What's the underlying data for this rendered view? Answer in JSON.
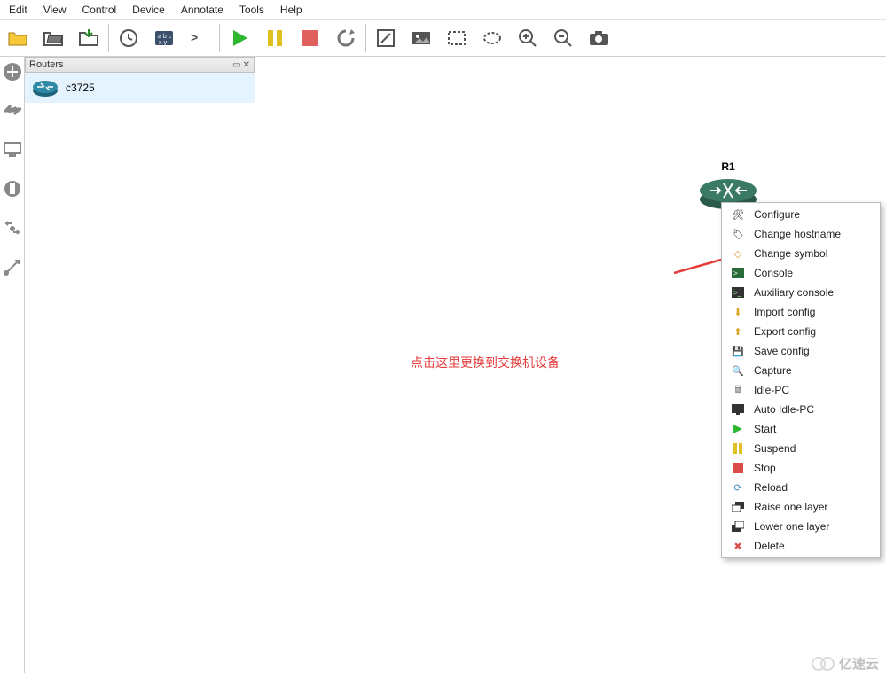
{
  "menu": [
    "Edit",
    "View",
    "Control",
    "Device",
    "Annotate",
    "Tools",
    "Help"
  ],
  "sidebar": {
    "title": "Routers",
    "item": "c3725"
  },
  "canvas": {
    "router_label": "R1",
    "annotation_text": "点击这里更换到交换机设备"
  },
  "context_menu": [
    {
      "label": "Configure"
    },
    {
      "label": "Change hostname"
    },
    {
      "label": "Change symbol"
    },
    {
      "label": "Console"
    },
    {
      "label": "Auxiliary console"
    },
    {
      "label": "Import config"
    },
    {
      "label": "Export config"
    },
    {
      "label": "Save config"
    },
    {
      "label": "Capture"
    },
    {
      "label": "Idle-PC"
    },
    {
      "label": "Auto Idle-PC"
    },
    {
      "label": "Start"
    },
    {
      "label": "Suspend"
    },
    {
      "label": "Stop"
    },
    {
      "label": "Reload"
    },
    {
      "label": "Raise one layer"
    },
    {
      "label": "Lower one layer"
    },
    {
      "label": "Delete"
    }
  ],
  "watermark": "亿速云"
}
